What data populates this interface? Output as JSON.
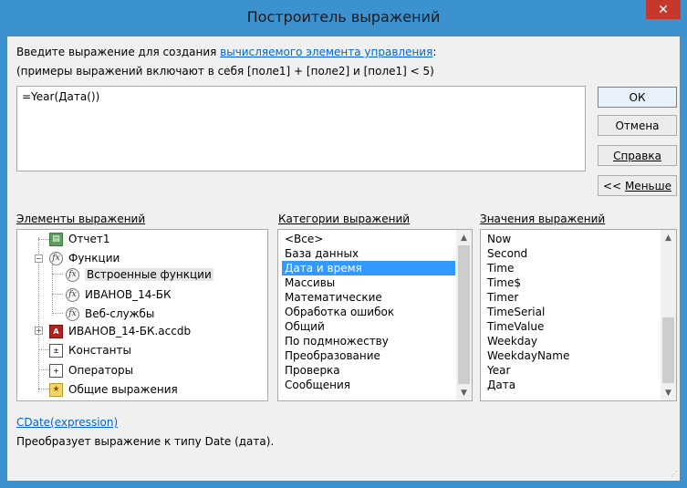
{
  "window": {
    "title": "Построитель выражений",
    "close_label": "✕"
  },
  "intro": {
    "line1_before": "Введите выражение для создания ",
    "line1_link": "вычисляемого элемента управления",
    "line1_after": ":",
    "line2": "(примеры выражений включают в себя [поле1] + [поле2] и [поле1] < 5)"
  },
  "expression": {
    "value": "=Year(Дата())"
  },
  "buttons": {
    "ok": "ОК",
    "cancel": "Отмена",
    "help": "Справка",
    "less_prefix": "<< ",
    "less": "Меньше"
  },
  "elements": {
    "label": "Элементы выражений",
    "items": [
      {
        "label": "Отчет1",
        "icon": "report-icon"
      },
      {
        "label": "Функции",
        "icon": "function-icon"
      },
      {
        "label": "Встроенные функции",
        "icon": "function-icon"
      },
      {
        "label": "ИВАНОВ_14-БК",
        "icon": "function-icon"
      },
      {
        "label": "Веб-службы",
        "icon": "function-icon"
      },
      {
        "label": "ИВАНОВ_14-БК.accdb",
        "icon": "database-icon"
      },
      {
        "label": "Константы",
        "icon": "constants-icon"
      },
      {
        "label": "Операторы",
        "icon": "operators-icon"
      },
      {
        "label": "Общие выражения",
        "icon": "common-expressions-icon"
      }
    ]
  },
  "categories": {
    "label": "Категории выражений",
    "items": [
      "<Все>",
      "База данных",
      "Дата и время",
      "Массивы",
      "Математические",
      "Обработка ошибок",
      "Общий",
      "По подмножеству",
      "Преобразование",
      "Проверка",
      "Сообщения"
    ],
    "selected": "Дата и время"
  },
  "values": {
    "label": "Значения выражений",
    "items": [
      "Now",
      "Second",
      "Time",
      "Time$",
      "Timer",
      "TimeSerial",
      "TimeValue",
      "Weekday",
      "WeekdayName",
      "Year",
      "Дата"
    ]
  },
  "footer": {
    "syntax": "CDate(expression)",
    "description": "Преобразует выражение к типу Date (дата)."
  },
  "colors": {
    "title_bar": "#3c92cf",
    "selection": "#3399ff",
    "link": "#0066cc",
    "close": "#c4392b"
  }
}
